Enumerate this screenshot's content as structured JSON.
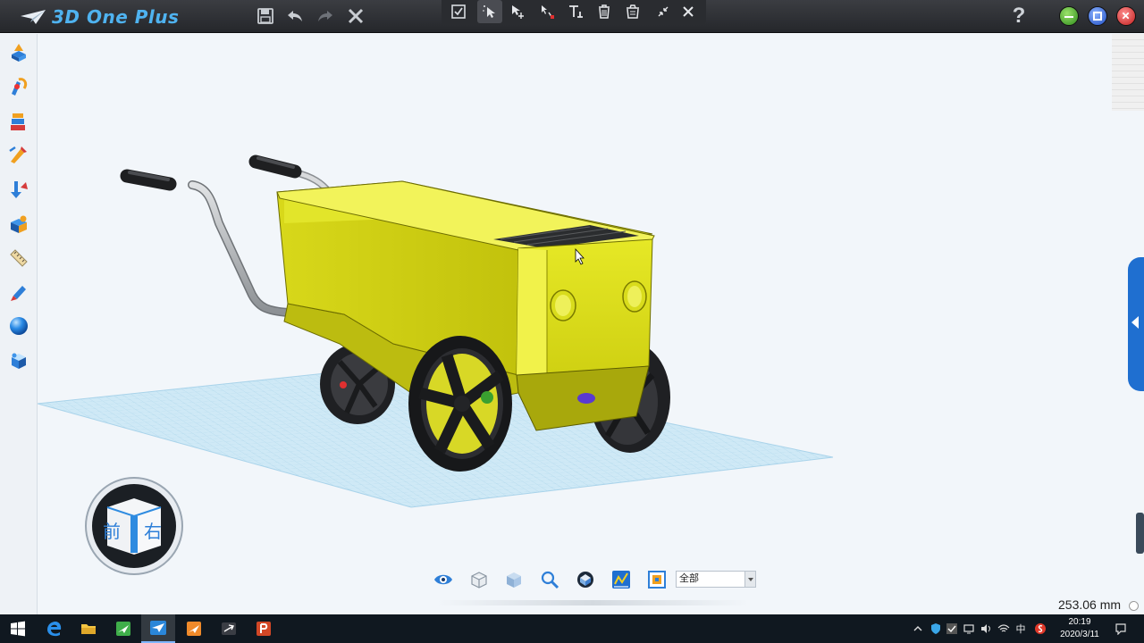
{
  "app": {
    "title": "3D One Plus"
  },
  "titlebar": {
    "file_buttons": [
      {
        "name": "save-icon"
      },
      {
        "name": "undo-icon"
      },
      {
        "name": "redo-icon"
      },
      {
        "name": "cancel-x-icon"
      }
    ],
    "tools": [
      {
        "name": "confirm-checkbox-icon"
      },
      {
        "name": "select-pointer-icon",
        "active": true
      },
      {
        "name": "move-arrow-icon"
      },
      {
        "name": "line-tool-icon"
      },
      {
        "name": "text-tool-icon"
      },
      {
        "name": "delete-icon"
      },
      {
        "name": "clear-all-icon"
      },
      {
        "name": "collapse-arrows-icon"
      },
      {
        "name": "close-toolbar-icon"
      }
    ],
    "help_label": "?"
  },
  "sidebar": {
    "items": [
      {
        "name": "basic-shapes-icon"
      },
      {
        "name": "sketch-icon"
      },
      {
        "name": "sketch-edit-icon"
      },
      {
        "name": "special-features-icon"
      },
      {
        "name": "special-modify-icon"
      },
      {
        "name": "assembly-icon"
      },
      {
        "name": "measure-icon"
      },
      {
        "name": "color-paint-icon"
      },
      {
        "name": "material-sphere-icon"
      },
      {
        "name": "component-library-icon"
      }
    ]
  },
  "viewcube": {
    "front_label": "前",
    "right_label": "右"
  },
  "bottom_toolbar": {
    "buttons": [
      {
        "name": "view-eye-icon"
      },
      {
        "name": "wireframe-cube-icon"
      },
      {
        "name": "shaded-cube-icon"
      },
      {
        "name": "zoom-magnifier-icon"
      },
      {
        "name": "render-mode-icon"
      },
      {
        "name": "grid-toggle-icon"
      },
      {
        "name": "filter-icon"
      }
    ],
    "filter_select": {
      "value": "全部"
    }
  },
  "status": {
    "measure": "253.06 mm"
  },
  "taskbar": {
    "apps": [
      {
        "name": "windows-start-icon"
      },
      {
        "name": "edge-browser-icon"
      },
      {
        "name": "file-explorer-icon"
      },
      {
        "name": "green-app-icon"
      },
      {
        "name": "3d-one-plus-task-icon",
        "active": true
      },
      {
        "name": "orange-app-icon"
      },
      {
        "name": "dark-app-icon"
      },
      {
        "name": "powerpoint-icon"
      }
    ],
    "ime_label": "中",
    "clock_time": "20:19",
    "clock_date": "2020/3/11"
  },
  "colors": {
    "model_yellow": "#dfe21a",
    "grid_blue": "#b7dcef",
    "accent_blue": "#1f6fd0",
    "titlebar_dark": "#2b2d31"
  }
}
